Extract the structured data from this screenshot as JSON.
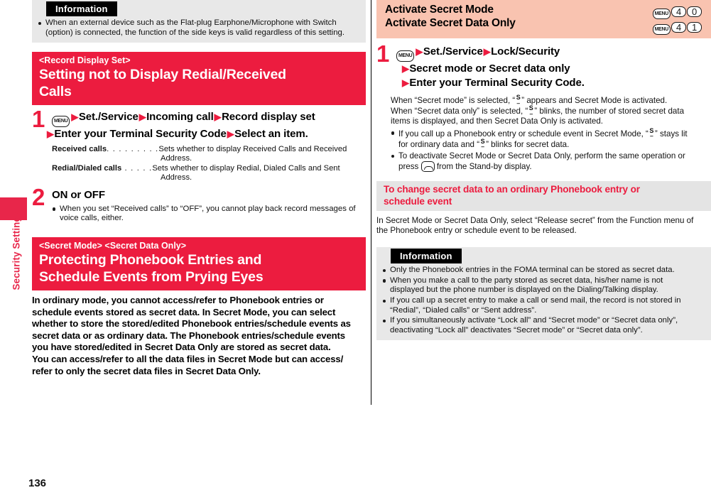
{
  "sidebar": {
    "chapter_label": "Security Settings"
  },
  "page_number": "136",
  "left": {
    "information_top": {
      "tag": "Information",
      "items": [
        {
          "line1": "When an external device such as the Flat-plug Earphone/Microphone with Switch",
          "line2": "(option) is connected, the function of the side keys is valid regardless of this setting."
        }
      ]
    },
    "section1": {
      "sub_title": "<Record Display Set>",
      "title_line1": "Setting not to Display Redial/Received",
      "title_line2": "Calls",
      "step1": {
        "num": "1",
        "key": "MENU",
        "line1_a": "Set./Service",
        "line1_b": "Incoming call",
        "line1_c": "Record display set",
        "line2_a": "Enter your Terminal Security Code",
        "line2_b": "Select an item.",
        "defs": [
          {
            "term": "Received calls",
            "dots": ". . . . . . . . .",
            "desc": "Sets whether to display Received Calls and Received",
            "desc_cont": "Address."
          },
          {
            "term": "Redial/Dialed calls",
            "dots": " . . . . .",
            "desc": "Sets whether to display Redial, Dialed Calls and Sent",
            "desc_cont": "Address."
          }
        ]
      },
      "step2": {
        "num": "2",
        "heading": "ON or OFF",
        "bullet_line1": "When you set “Received calls” to “OFF”, you cannot play back record messages",
        "bullet_line2": "of voice calls, either."
      }
    },
    "section2": {
      "sub_title": "<Secret Mode> <Secret Data Only>",
      "title_line1": "Protecting Phonebook Entries and",
      "title_line2": "Schedule Events from Prying Eyes",
      "paragraph": [
        "In ordinary mode, you cannot access/refer to Phonebook entries or",
        "schedule events stored as secret data. In Secret Mode, you can select",
        "whether to store the stored/edited Phonebook entries/schedule events as",
        "secret data or as ordinary data. The Phonebook entries/schedule events",
        "you have stored/edited in Secret Data Only are stored as secret data.",
        "You can access/refer to all the data files in Secret Mode but can access/",
        "refer to only the secret data files in Secret Data Only."
      ]
    }
  },
  "right": {
    "header": {
      "title_line1": "Activate Secret Mode",
      "title_line2": "Activate Secret Data Only",
      "keys_row1": [
        "MENU",
        "4",
        "0"
      ],
      "keys_row2": [
        "MENU",
        "4",
        "1"
      ]
    },
    "step1": {
      "num": "1",
      "key": "MENU",
      "line1_a": "Set./Service",
      "line1_b": "Lock/Security",
      "line2": "Secret mode or Secret data only",
      "line3": "Enter your Terminal Security Code."
    },
    "explain": [
      "When “Secret mode” is selected, “",
      "” appears and Secret Mode is activated.",
      "When “Secret data only” is selected, “",
      "” blinks, the number of stored secret data",
      "items is displayed, and then Secret Data Only is activated."
    ],
    "bullets": [
      {
        "seg1": "If you call up a Phonebook entry or schedule event in Secret Mode, “",
        "seg2": "” stays lit",
        "line2_a": "for ordinary data and “",
        "line2_b": "” blinks for secret data."
      },
      {
        "line1": "To deactivate Secret Mode or Secret Data Only, perform the same operation or",
        "line2_a": "press",
        "line2_b": "from the Stand-by display."
      }
    ],
    "grey_heading_line1": "To change secret data to an ordinary Phonebook entry or",
    "grey_heading_line2": "schedule event",
    "grey_body_line1": "In Secret Mode or Secret Data Only, select “Release secret” from the Function menu of",
    "grey_body_line2": "the Phonebook entry or schedule event to be released.",
    "information": {
      "tag": "Information",
      "items": [
        {
          "line1": "Only the Phonebook entries in the FOMA terminal can be stored as secret data."
        },
        {
          "line1": "When you make a call to the party stored as secret data, his/her name is not",
          "line2": "displayed but the phone number is displayed on the Dialing/Talking display."
        },
        {
          "line1": "If you call up a secret entry to make a call or send mail, the record is not stored in",
          "line2": "“Redial”, “Dialed calls” or “Sent address”."
        },
        {
          "line1": "If you simultaneously activate “Lock all” and “Secret mode” or “Secret data only”,",
          "line2": "deactivating “Lock all” deactivates “Secret mode” or “Secret data only”."
        }
      ]
    }
  },
  "colors": {
    "red": "#ec1c3f",
    "pink": "#f9c3b0",
    "grey": "#e4e4e4",
    "info_grey": "#e8e8e8"
  }
}
